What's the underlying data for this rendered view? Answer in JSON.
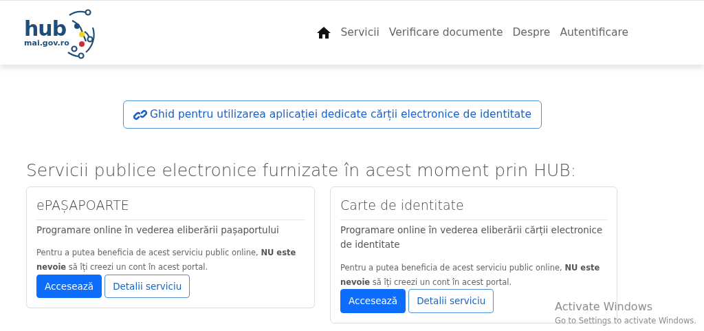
{
  "logo": {
    "wordmark": "hub",
    "domain": "mai.gov.ro"
  },
  "nav": [
    {
      "kind": "home"
    },
    {
      "kind": "link",
      "label": "Servicii"
    },
    {
      "kind": "link",
      "label": "Verificare documente"
    },
    {
      "kind": "link",
      "label": "Despre"
    },
    {
      "kind": "link",
      "label": "Autentificare"
    }
  ],
  "guide_button": {
    "label": "Ghid pentru utilizarea aplicației dedicate cărții electronice de identitate"
  },
  "heading": "Servicii publice electronice furnizate în acest moment prin  HUB:",
  "services": [
    {
      "title": "ePAȘAPOARTE",
      "subtitle": "Programare online în vederea eliberării pașaportului",
      "note": "Pentru a putea beneficia de acest serviciu public online, **NU este nevoie** să îți creezi un cont în acest portal.",
      "buttons": [
        "Accesează",
        "Detalii serviciu"
      ]
    },
    {
      "title": "Carte de identitate",
      "subtitle": "Programare online în vederea eliberării cărții electronice de identitate",
      "note": "Pentru a putea beneficia de acest serviciu public online, **NU este nevoie** să îți creezi un cont în acest portal.",
      "buttons": [
        "Accesează",
        "Detalii serviciu"
      ]
    }
  ],
  "os_notice": {
    "title": "Activate Windows",
    "text": "Go to Settings to activate Windows."
  }
}
